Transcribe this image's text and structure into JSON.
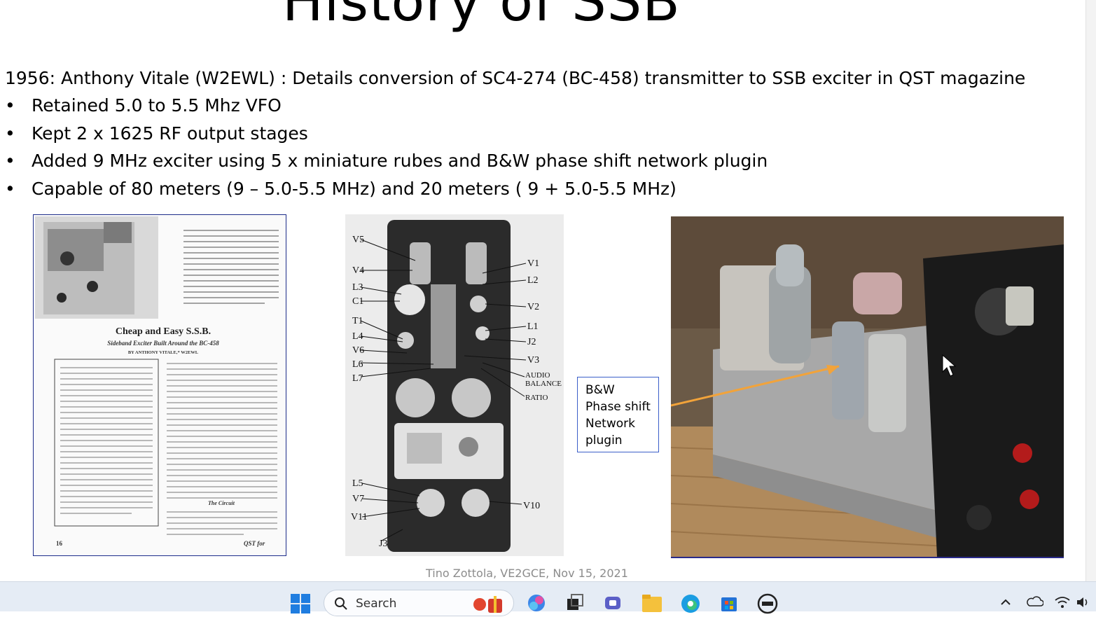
{
  "slide": {
    "title": "History of SSB",
    "lead": "1956: Anthony Vitale (W2EWL) : Details conversion of SC4-274 (BC-458) transmitter to SSB exciter in QST magazine",
    "bullet_glyph": "•",
    "bullets": [
      "Retained 5.0 to 5.5 Mhz VFO",
      "Kept 2 x 1625 RF output stages",
      "Added 9 MHz exciter using 5 x miniature rubes and B&W phase shift network plugin",
      "Capable of 80 meters (9 – 5.0-5.5 MHz) and 20 meters ( 9 + 5.0-5.5 MHz)"
    ],
    "article": {
      "headline": "Cheap and Easy S.S.B.",
      "subhead": "Sideband Exciter Built Around the BC-458",
      "byline": "BY ANTHONY VITALE,* W2EWL",
      "section": "The Circuit",
      "page_number": "16",
      "journal": "QST for"
    },
    "diagram_labels": {
      "left": [
        "V5",
        "V4",
        "L3",
        "C1",
        "T1",
        "L4",
        "V6",
        "L6",
        "L7",
        "L5",
        "V7",
        "V11",
        "J3"
      ],
      "right": [
        "V1",
        "L2",
        "V2",
        "L1",
        "J2",
        "V3",
        "AUDIO",
        "BALANCE",
        "RATIO",
        "V10"
      ]
    },
    "callout": [
      "B&W",
      "Phase shift",
      "Network",
      "plugin"
    ],
    "footer": "Tino Zottola, VE2GCE, Nov 15, 2021"
  },
  "taskbar": {
    "search_label": "Search",
    "icons": [
      "start-icon",
      "search-icon",
      "widgets-icon",
      "copilot-icon",
      "task-view-icon",
      "teams-icon",
      "file-explorer-icon",
      "edge-icon",
      "store-icon",
      "dell-icon"
    ],
    "tray": [
      "chevron-up-icon",
      "onedrive-icon",
      "wifi-icon",
      "speaker-icon"
    ]
  },
  "colors": {
    "accent_blue": "#3b5ec9",
    "frame_blue": "#1d2c8a",
    "footer_gray": "#8c8c8c",
    "taskbar": "#e5ecf5"
  }
}
